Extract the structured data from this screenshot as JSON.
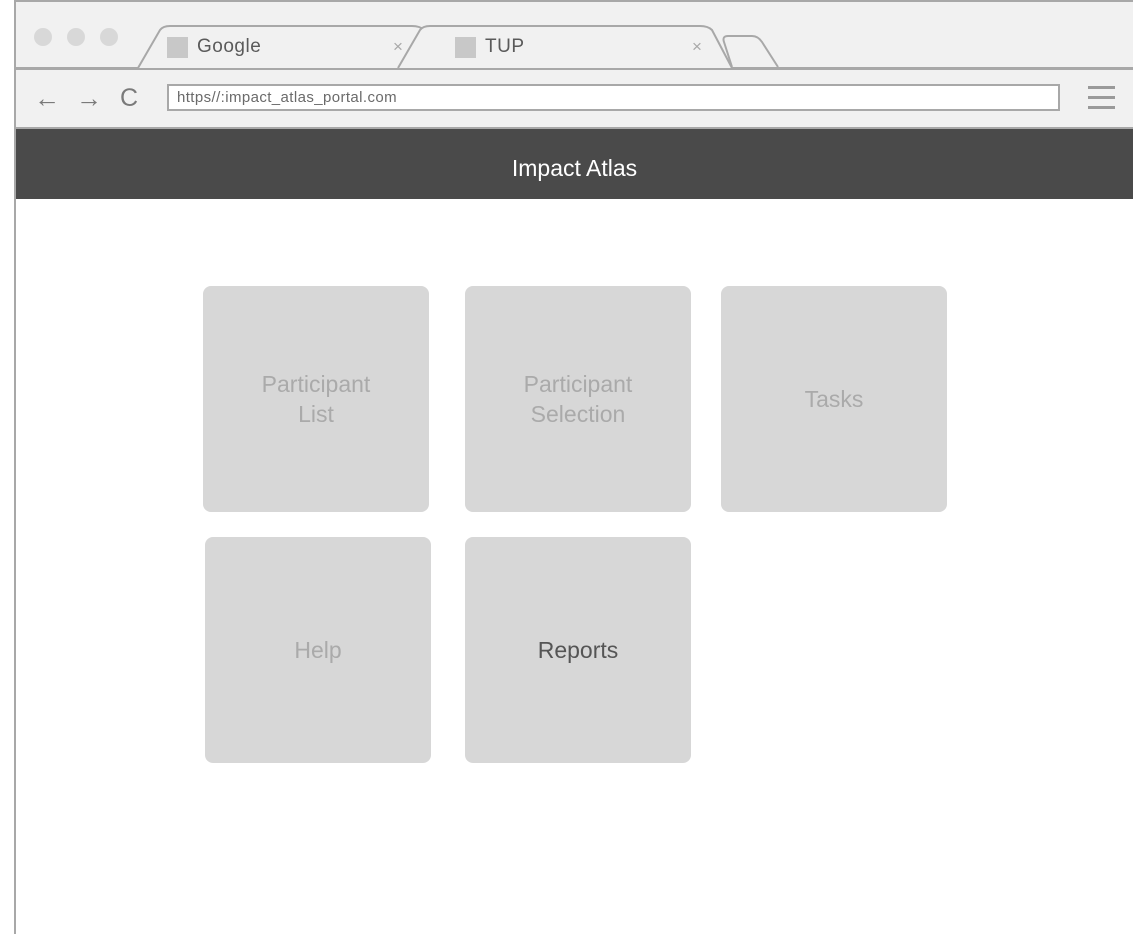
{
  "browser": {
    "tabs": [
      {
        "label": "Google",
        "close": "×"
      },
      {
        "label": "TUP",
        "close": "×"
      }
    ],
    "url": "https//:impact_atlas_portal.com",
    "nav": {
      "back": "←",
      "forward": "→",
      "reload": "C"
    }
  },
  "header": {
    "title": "Impact Atlas"
  },
  "tiles": [
    {
      "label": "Participant\nList",
      "active": false
    },
    {
      "label": "Participant\nSelection",
      "active": false
    },
    {
      "label": "Tasks",
      "active": false
    },
    {
      "label": "Help",
      "active": false
    },
    {
      "label": "Reports",
      "active": true
    }
  ],
  "colors": {
    "header_bg": "#4a4a4a",
    "tile_bg": "#d7d7d7",
    "tile_text": "#aaaaaa",
    "tile_text_active": "#555555"
  }
}
